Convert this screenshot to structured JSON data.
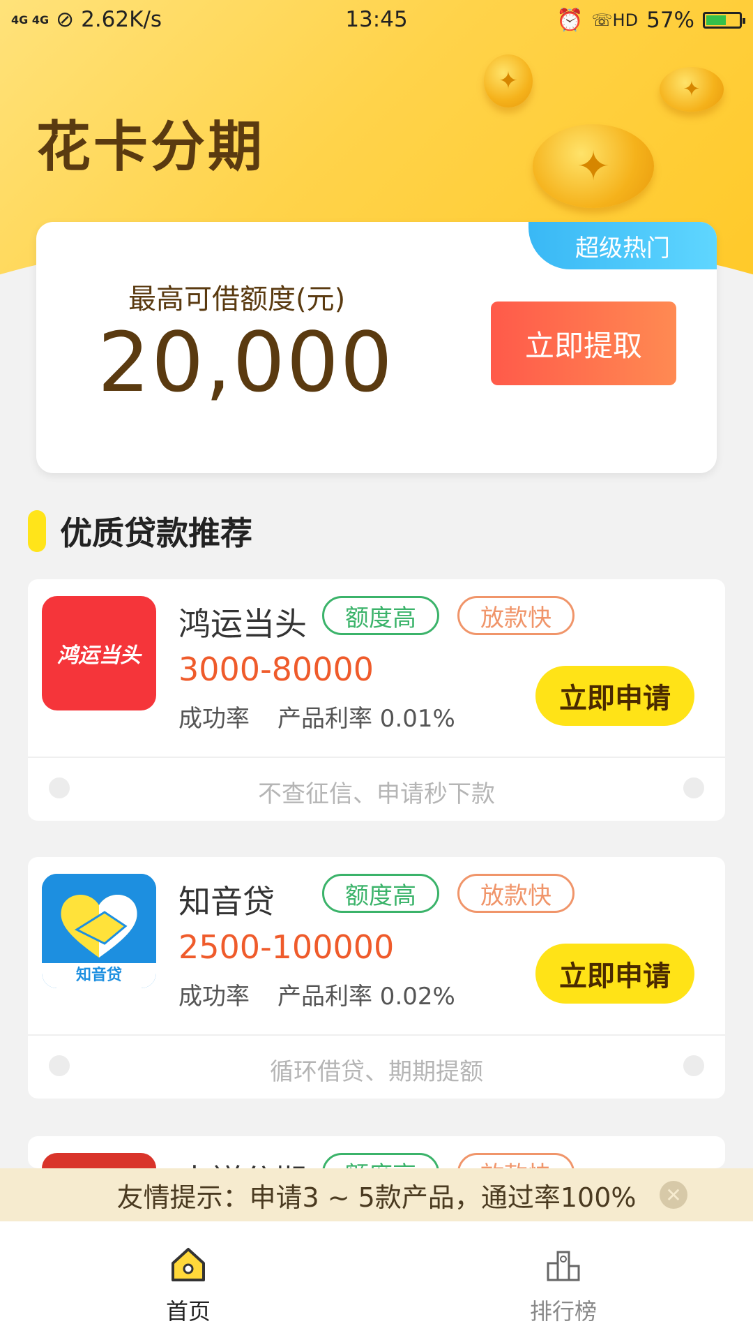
{
  "status_bar": {
    "signal": "4G 4G",
    "speed": "2.62K/s",
    "time": "13:45",
    "battery": "57%",
    "battery_level": 0.57
  },
  "header": {
    "title": "花卡分期"
  },
  "hero": {
    "badge": "超级热门",
    "limit_label": "最高可借额度(元)",
    "limit_amount": "20,000",
    "claim_button": "立即提取"
  },
  "section": {
    "title": "优质贷款推荐"
  },
  "products": [
    {
      "logo_text": "鸿运当头",
      "name": "鸿运当头",
      "tag1": "额度高",
      "tag2": "放款快",
      "range": "3000-80000",
      "success_label": "成功率",
      "rate_label": "产品利率 0.01%",
      "apply_button": "立即申请",
      "desc": "不查征信、申请秒下款"
    },
    {
      "logo_text": "知音贷",
      "name": "知音贷",
      "tag1": "额度高",
      "tag2": "放款快",
      "range": "2500-100000",
      "success_label": "成功率",
      "rate_label": "产品利率 0.02%",
      "apply_button": "立即申请",
      "desc": "循环借贷、期期提额"
    },
    {
      "name": "吉祥分期",
      "tag1": "额度高",
      "tag2": "放款快"
    }
  ],
  "tip": {
    "text": "友情提示：申请3 ~ 5款产品，通过率100%",
    "close_icon": "close-icon"
  },
  "tabbar": {
    "home": "首页",
    "rank": "排行榜"
  },
  "colors": {
    "brand_yellow": "#ffd34a",
    "accent_red": "#ff5a4a",
    "range_orange": "#ef5b2b",
    "badge_blue": "#39b8f5"
  }
}
